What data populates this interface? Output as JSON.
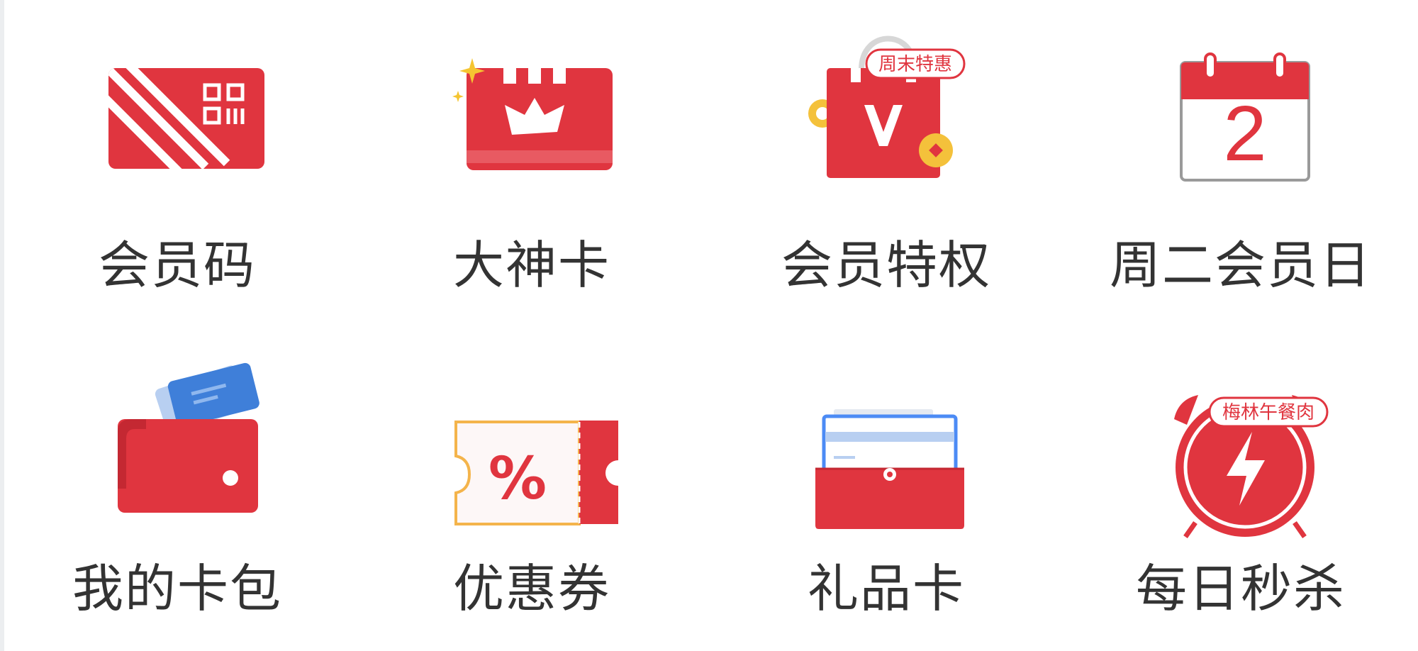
{
  "menu": {
    "items": [
      {
        "label": "会员码",
        "icon": "member-code-card-icon"
      },
      {
        "label": "大神卡",
        "icon": "crown-card-icon"
      },
      {
        "label": "会员特权",
        "icon": "shopping-bag-v-icon",
        "badge": "周末特惠"
      },
      {
        "label": "周二会员日",
        "icon": "calendar-2-icon",
        "calendar_number": "2"
      },
      {
        "label": "我的卡包",
        "icon": "wallet-icon"
      },
      {
        "label": "优惠券",
        "icon": "coupon-icon",
        "symbol": "%"
      },
      {
        "label": "礼品卡",
        "icon": "gift-card-box-icon"
      },
      {
        "label": "每日秒杀",
        "icon": "alarm-clock-flash-icon",
        "badge": "梅林午餐肉"
      }
    ]
  },
  "colors": {
    "accent_red": "#e0353f",
    "label_text": "#333333",
    "coin_gold": "#f4c13b",
    "blue": "#3f7fd9",
    "coupon_border": "#f4b44b"
  }
}
